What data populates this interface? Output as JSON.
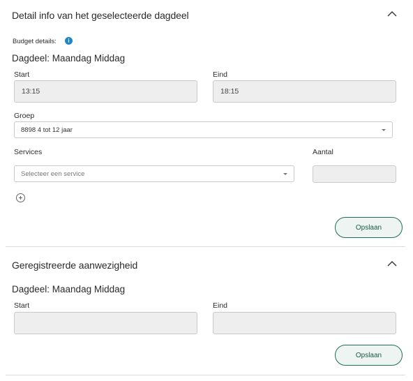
{
  "detail": {
    "title": "Detail info van het geselecteerde dagdeel",
    "budget_label": "Budget details:",
    "info_icon": "i",
    "dagdeel": "Dagdeel: Maandag Middag",
    "start_label": "Start",
    "start_value": "13:15",
    "eind_label": "Eind",
    "eind_value": "18:15",
    "groep_label": "Groep",
    "groep_value": "8898 4 tot 12 jaar",
    "services_label": "Services",
    "services_placeholder": "Selecteer een service",
    "aantal_label": "Aantal",
    "aantal_value": "",
    "save_label": "Opslaan"
  },
  "registered": {
    "title": "Geregistreerde aanwezigheid",
    "dagdeel": "Dagdeel: Maandag Middag",
    "start_label": "Start",
    "start_value": "",
    "eind_label": "Eind",
    "eind_value": "",
    "save_label": "Opslaan"
  },
  "icons": {
    "collapse": "chevron-up-icon",
    "info": "info-icon",
    "add": "plus-circle-icon",
    "dropdown": "caret-down-icon"
  },
  "colors": {
    "accent": "#1e6e5b",
    "info": "#1f86c9",
    "field_bg": "#eeeeee"
  }
}
